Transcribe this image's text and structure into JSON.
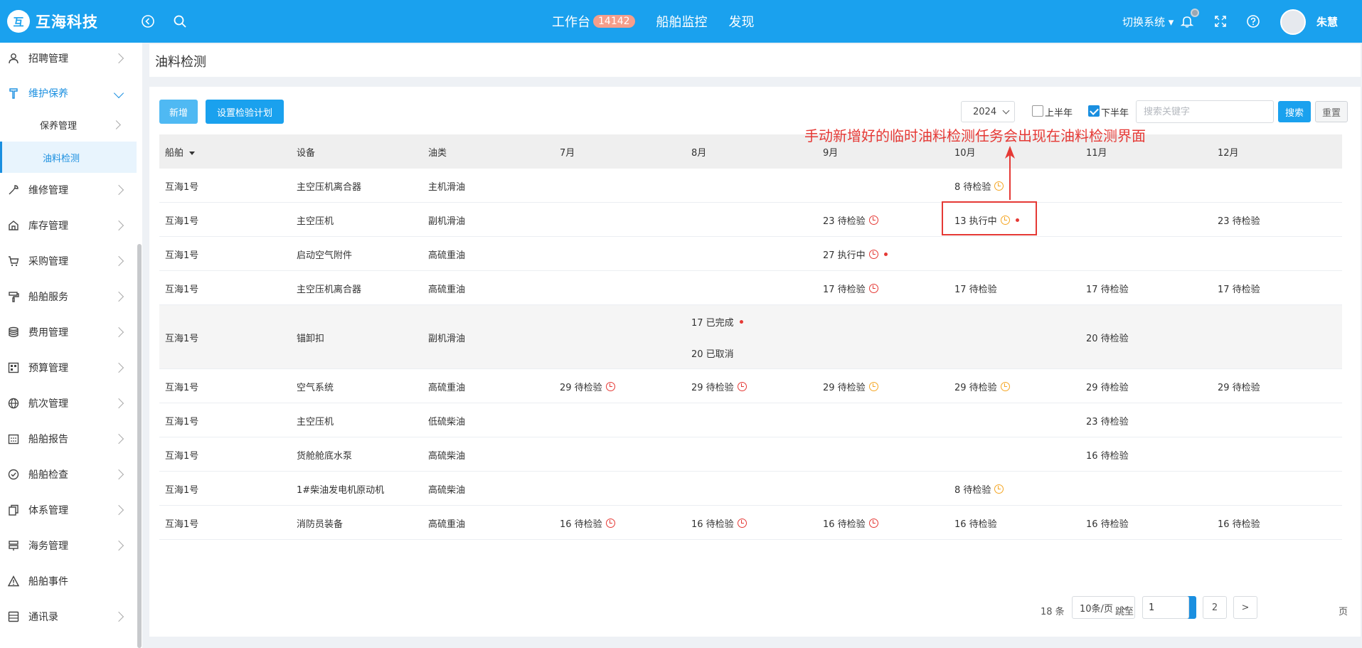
{
  "header": {
    "brand": "互海科技",
    "logo_mark": "互",
    "nav": [
      {
        "label": "工作台",
        "badge": "14142"
      },
      {
        "label": "船舶监控"
      },
      {
        "label": "发现"
      }
    ],
    "switch_system": "切换系统 ▾",
    "user_name": "朱慧",
    "icons": [
      "back-circle-icon",
      "search-icon",
      "bell-icon",
      "fullscreen-icon",
      "help-icon"
    ]
  },
  "sidebar": {
    "items": [
      {
        "label": "招聘管理",
        "icon": "user-icon"
      },
      {
        "label": "维护保养",
        "icon": "wrench-icon",
        "open": true
      },
      {
        "label": "保养管理",
        "sub": true
      },
      {
        "label": "油料检测",
        "sub": true,
        "active": true
      },
      {
        "label": "维修管理",
        "icon": "tool-icon"
      },
      {
        "label": "库存管理",
        "icon": "home-icon"
      },
      {
        "label": "采购管理",
        "icon": "cart-icon"
      },
      {
        "label": "船舶服务",
        "icon": "roller-icon"
      },
      {
        "label": "费用管理",
        "icon": "database-icon"
      },
      {
        "label": "预算管理",
        "icon": "grid-icon"
      },
      {
        "label": "航次管理",
        "icon": "globe-icon"
      },
      {
        "label": "船舶报告",
        "icon": "calendar-icon"
      },
      {
        "label": "船舶检查",
        "icon": "check-circle-icon"
      },
      {
        "label": "体系管理",
        "icon": "documents-icon"
      },
      {
        "label": "海务管理",
        "icon": "signpost-icon"
      },
      {
        "label": "船舶事件",
        "icon": "warning-icon"
      },
      {
        "label": "通讯录",
        "icon": "contacts-icon"
      }
    ]
  },
  "page": {
    "title": "油料检测"
  },
  "toolbar": {
    "add_label": "新增",
    "plan_label": "设置检验计划",
    "year": "2024",
    "first_half_label": "上半年",
    "first_half_checked": false,
    "second_half_label": "下半年",
    "second_half_checked": true,
    "search_placeholder": "搜索关键字",
    "search_label": "搜索",
    "reset_label": "重置"
  },
  "table": {
    "columns": [
      "船舶",
      "设备",
      "油类",
      "7月",
      "8月",
      "9月",
      "10月",
      "11月",
      "12月"
    ],
    "rows": [
      {
        "ship": "互海1号",
        "device": "主空压机离合器",
        "oil": "主机滑油",
        "months": [
          [],
          [],
          [],
          [
            {
              "text": "8 待检验",
              "clock": "orange"
            }
          ],
          [],
          []
        ]
      },
      {
        "ship": "互海1号",
        "device": "主空压机",
        "oil": "副机滑油",
        "months": [
          [],
          [],
          [
            {
              "text": "23 待检验",
              "clock": "red"
            }
          ],
          [
            {
              "text": "13 执行中",
              "clock": "orange",
              "dot": true
            }
          ],
          [],
          [
            {
              "text": "23 待检验"
            }
          ]
        ]
      },
      {
        "ship": "互海1号",
        "device": "启动空气附件",
        "oil": "高硫重油",
        "months": [
          [],
          [],
          [
            {
              "text": "27 执行中",
              "clock": "red",
              "dot": true
            }
          ],
          [],
          [],
          []
        ]
      },
      {
        "ship": "互海1号",
        "device": "主空压机离合器",
        "oil": "高硫重油",
        "months": [
          [],
          [],
          [
            {
              "text": "17 待检验",
              "clock": "red"
            }
          ],
          [
            {
              "text": "17 待检验"
            }
          ],
          [
            {
              "text": "17 待检验"
            }
          ],
          [
            {
              "text": "17 待检验"
            }
          ]
        ]
      },
      {
        "ship": "互海1号",
        "device": "锚卸扣",
        "oil": "副机滑油",
        "months": [
          [],
          [
            {
              "text": "17 已完成",
              "dot": true
            },
            {
              "text": "20 已取消"
            }
          ],
          [],
          [],
          [
            {
              "text": "20 待检验"
            }
          ],
          []
        ]
      },
      {
        "ship": "互海1号",
        "device": "空气系统",
        "oil": "高硫重油",
        "months": [
          [
            {
              "text": "29 待检验",
              "clock": "red"
            }
          ],
          [
            {
              "text": "29 待检验",
              "clock": "red"
            }
          ],
          [
            {
              "text": "29 待检验",
              "clock": "orange"
            }
          ],
          [
            {
              "text": "29 待检验",
              "clock": "orange"
            }
          ],
          [
            {
              "text": "29 待检验"
            }
          ],
          [
            {
              "text": "29 待检验"
            }
          ]
        ]
      },
      {
        "ship": "互海1号",
        "device": "主空压机",
        "oil": "低硫柴油",
        "months": [
          [],
          [],
          [],
          [],
          [
            {
              "text": "23 待检验"
            }
          ],
          []
        ]
      },
      {
        "ship": "互海1号",
        "device": "货舱舱底水泵",
        "oil": "高硫柴油",
        "months": [
          [],
          [],
          [],
          [],
          [
            {
              "text": "16 待检验"
            }
          ],
          []
        ]
      },
      {
        "ship": "互海1号",
        "device": "1#柴油发电机原动机",
        "oil": "高硫柴油",
        "months": [
          [],
          [],
          [],
          [
            {
              "text": "8 待检验",
              "clock": "orange"
            }
          ],
          [],
          []
        ]
      },
      {
        "ship": "互海1号",
        "device": "消防员装备",
        "oil": "高硫重油",
        "months": [
          [
            {
              "text": "16 待检验",
              "clock": "red"
            }
          ],
          [
            {
              "text": "16 待检验",
              "clock": "red"
            }
          ],
          [
            {
              "text": "16 待检验",
              "clock": "red"
            }
          ],
          [
            {
              "text": "16 待检验"
            }
          ],
          [
            {
              "text": "16 待检验"
            }
          ],
          [
            {
              "text": "16 待检验"
            }
          ]
        ]
      }
    ]
  },
  "pagination": {
    "total": "18 条",
    "page_size": "10条/页",
    "prev": "<",
    "next": ">",
    "pages": [
      "1",
      "2"
    ],
    "current": "1",
    "jump_label": "跳至",
    "jump_value": "1",
    "page_suffix": "页"
  },
  "annotation": {
    "text": "手动新增好的临时油料检测任务会出现在油料检测界面"
  },
  "colors": {
    "header_bg": "#1aa1ee",
    "accent": "#1a8fe0",
    "annotation": "#e53935",
    "badge": "#f59e8b",
    "clock_red": "#e53935",
    "clock_orange": "#f5a623"
  }
}
